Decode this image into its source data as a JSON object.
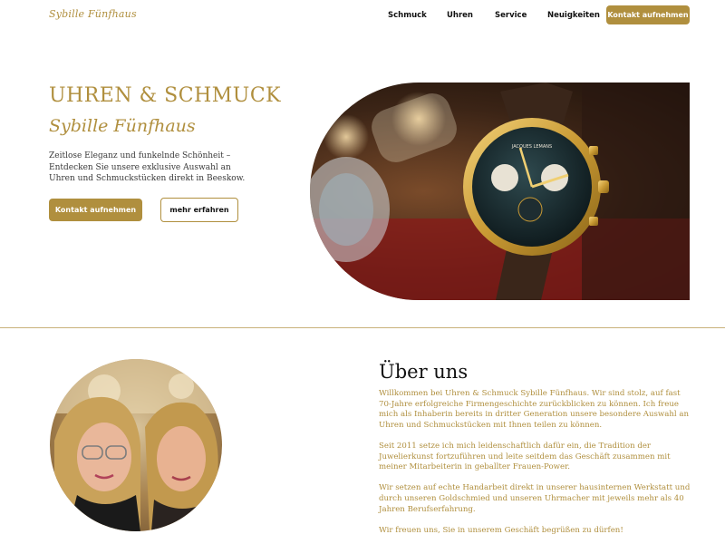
{
  "nav": {
    "logo": "Sybille Fünfhaus",
    "items": [
      "Schmuck",
      "Uhren",
      "Service",
      "Neuigkeiten"
    ],
    "cta": "Kontakt aufnehmen"
  },
  "hero": {
    "title": "UHREN & SCHMUCK",
    "subtitle": "Sybille Fünfhaus",
    "text": "Zeitlose Eleganz und funkelnde Schönheit – Entdecken Sie unsere exklusive Auswahl an Uhren und Schmuckstücken direkt in Beeskow.",
    "primary_button": "Kontakt aufnehmen",
    "secondary_button": "mehr erfahren",
    "watch_dial_text": "JACQUES LEMANS"
  },
  "about": {
    "title": "Über uns",
    "paragraphs": [
      "Willkommen bei Uhren & Schmuck Sybille Fünfhaus. Wir sind stolz, auf fast 70-Jahre erfolgreiche Firmengeschichte zurückblicken zu können. Ich freue mich als Inhaberin bereits in dritter Generation unsere besondere Auswahl an Uhren und Schmuckstücken mit Ihnen teilen zu können.",
      "Seit 2011 setze ich mich leidenschaftlich dafür ein, die Tradition der Juwelierkunst fortzuführen und leite seitdem das Geschäft zusammen mit meiner Mitarbeiterin in geballter Frauen-Power.",
      "Wir setzen auf echte Handarbeit direkt in unserer hausinternen Werkstatt und durch unseren Goldschmied und unseren Uhrmacher mit jeweils mehr als 40 Jahren Berufserfahrung.",
      "Wir freuen uns, Sie in unserem Geschäft begrüßen zu dürfen!"
    ]
  },
  "colors": {
    "gold": "#b08f3e",
    "text": "#111111"
  }
}
